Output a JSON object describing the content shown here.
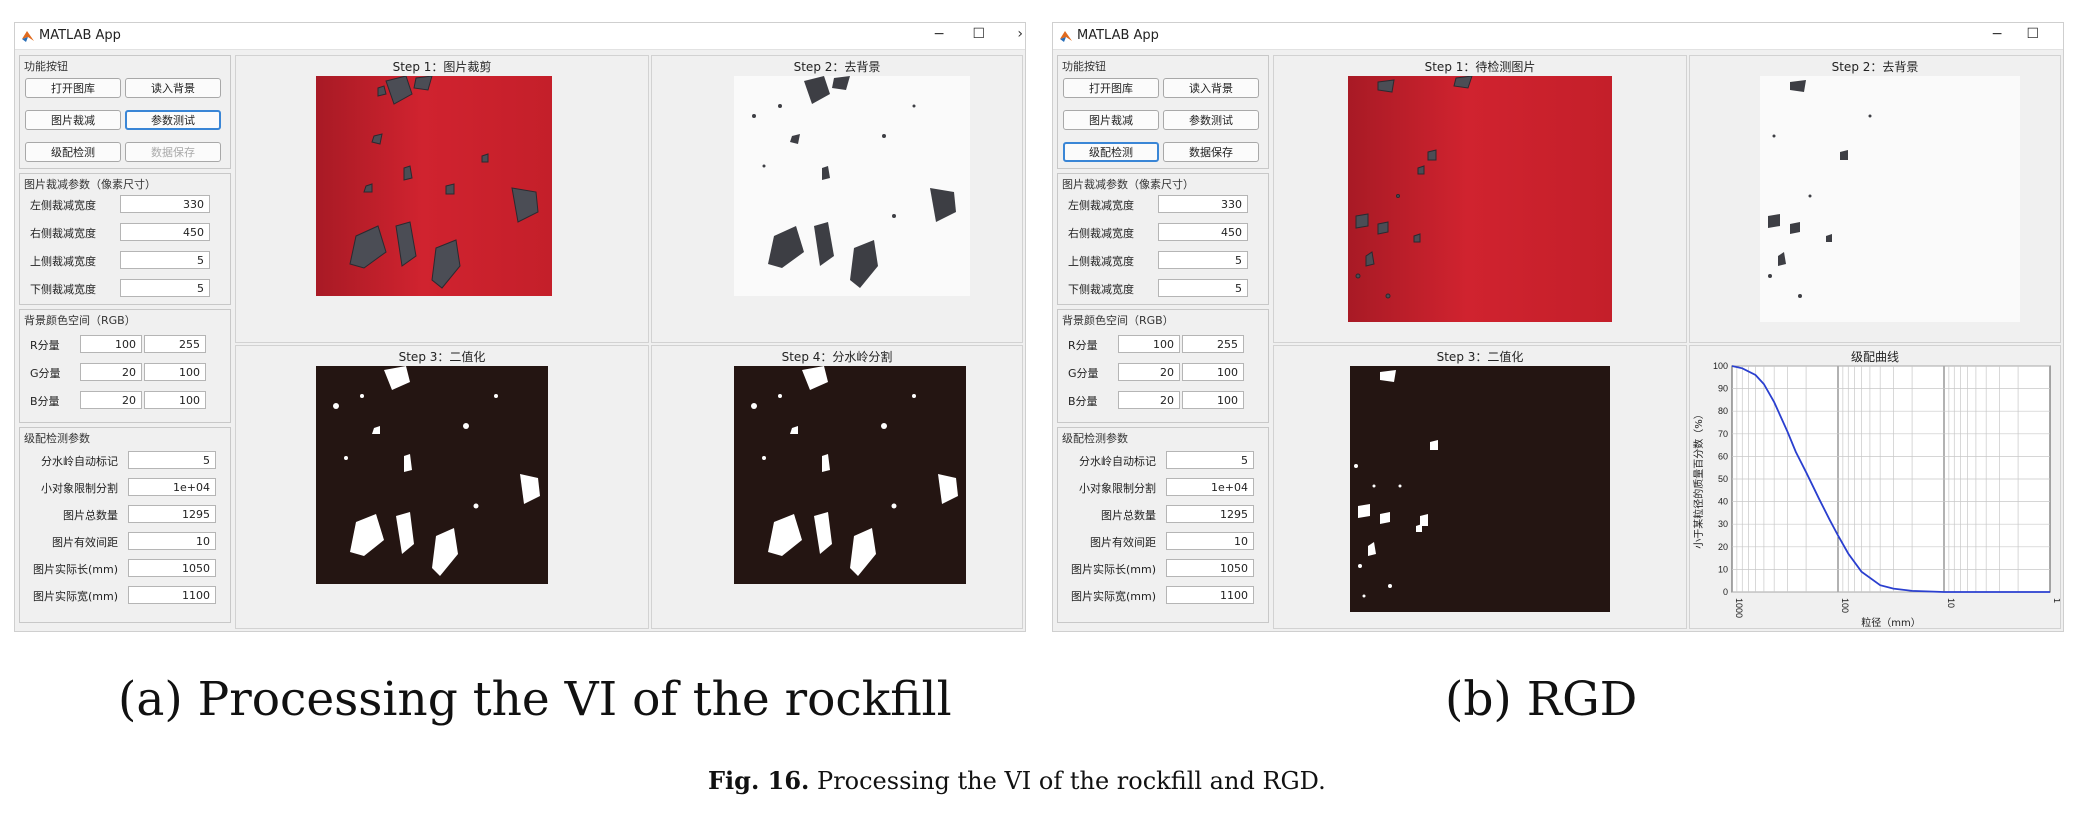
{
  "window_title": "MATLAB App",
  "window_controls": {
    "minimize": "−",
    "maximize": "☐",
    "close": "›"
  },
  "groups": {
    "functions": "功能按钮",
    "crop": "图片裁减参数（像素尺寸）",
    "color": "背景颜色空间（RGB）",
    "grading": "级配检测参数"
  },
  "buttons": {
    "open_gallery": "打开图库",
    "read_background": "读入背景",
    "crop_image": "图片裁减",
    "param_test": "参数测试",
    "grading_detect": "级配检测",
    "save_data": "数据保存"
  },
  "crop_fields": [
    {
      "label": "左侧裁减宽度",
      "value": "330"
    },
    {
      "label": "右侧裁减宽度",
      "value": "450"
    },
    {
      "label": "上侧裁减宽度",
      "value": "5"
    },
    {
      "label": "下侧裁减宽度",
      "value": "5"
    }
  ],
  "color_fields": [
    {
      "label": "R分量",
      "min": "100",
      "max": "255"
    },
    {
      "label": "G分量",
      "min": "20",
      "max": "100"
    },
    {
      "label": "B分量",
      "min": "20",
      "max": "100"
    }
  ],
  "grading_fields": [
    {
      "label": "分水岭自动标记",
      "value": "5"
    },
    {
      "label": "小对象限制分割",
      "value": "1e+04"
    },
    {
      "label": "图片总数量",
      "value": "1295"
    },
    {
      "label": "图片有效间距",
      "value": "10"
    },
    {
      "label": "图片实际长(mm)",
      "value": "1050"
    },
    {
      "label": "图片实际宽(mm)",
      "value": "1100"
    }
  ],
  "app_a": {
    "titles": {
      "step1": "Step 1：图片裁剪",
      "step2": "Step 2：去背景",
      "step3": "Step 3：二值化",
      "step4": "Step 4：分水岭分割"
    }
  },
  "app_b": {
    "titles": {
      "step1": "Step 1：待检测图片",
      "step2": "Step 2：去背景",
      "step3": "Step 3：二值化",
      "curve": "级配曲线"
    }
  },
  "chart_data": {
    "type": "line",
    "title": "级配曲线",
    "xlabel": "粒径（mm）",
    "ylabel": "小于某粒径的质量百分数（%）",
    "x_scale": "log",
    "x_reversed": true,
    "xlim": [
      1000,
      1
    ],
    "ylim": [
      0,
      100
    ],
    "xticks": [
      "1000",
      "100",
      "10",
      "1"
    ],
    "yticks": [
      "0",
      "10",
      "20",
      "30",
      "40",
      "50",
      "60",
      "70",
      "80",
      "90",
      "100"
    ],
    "grid": true,
    "series": [
      {
        "color": "#2a3fcf",
        "x": [
          1000,
          800,
          600,
          500,
          400,
          300,
          250,
          200,
          150,
          120,
          100,
          80,
          60,
          40,
          30,
          20,
          10,
          1
        ],
        "y": [
          100,
          99,
          96,
          92,
          84,
          71,
          62,
          53,
          41,
          32,
          25,
          17,
          9,
          3,
          1.5,
          0.5,
          0,
          0
        ]
      }
    ]
  },
  "caption_a": "(a) Processing the VI of the rockfill",
  "caption_b": "(b) RGD",
  "fig_label": "Fig. 16.",
  "fig_text": "Processing the VI of the rockfill and RGD."
}
